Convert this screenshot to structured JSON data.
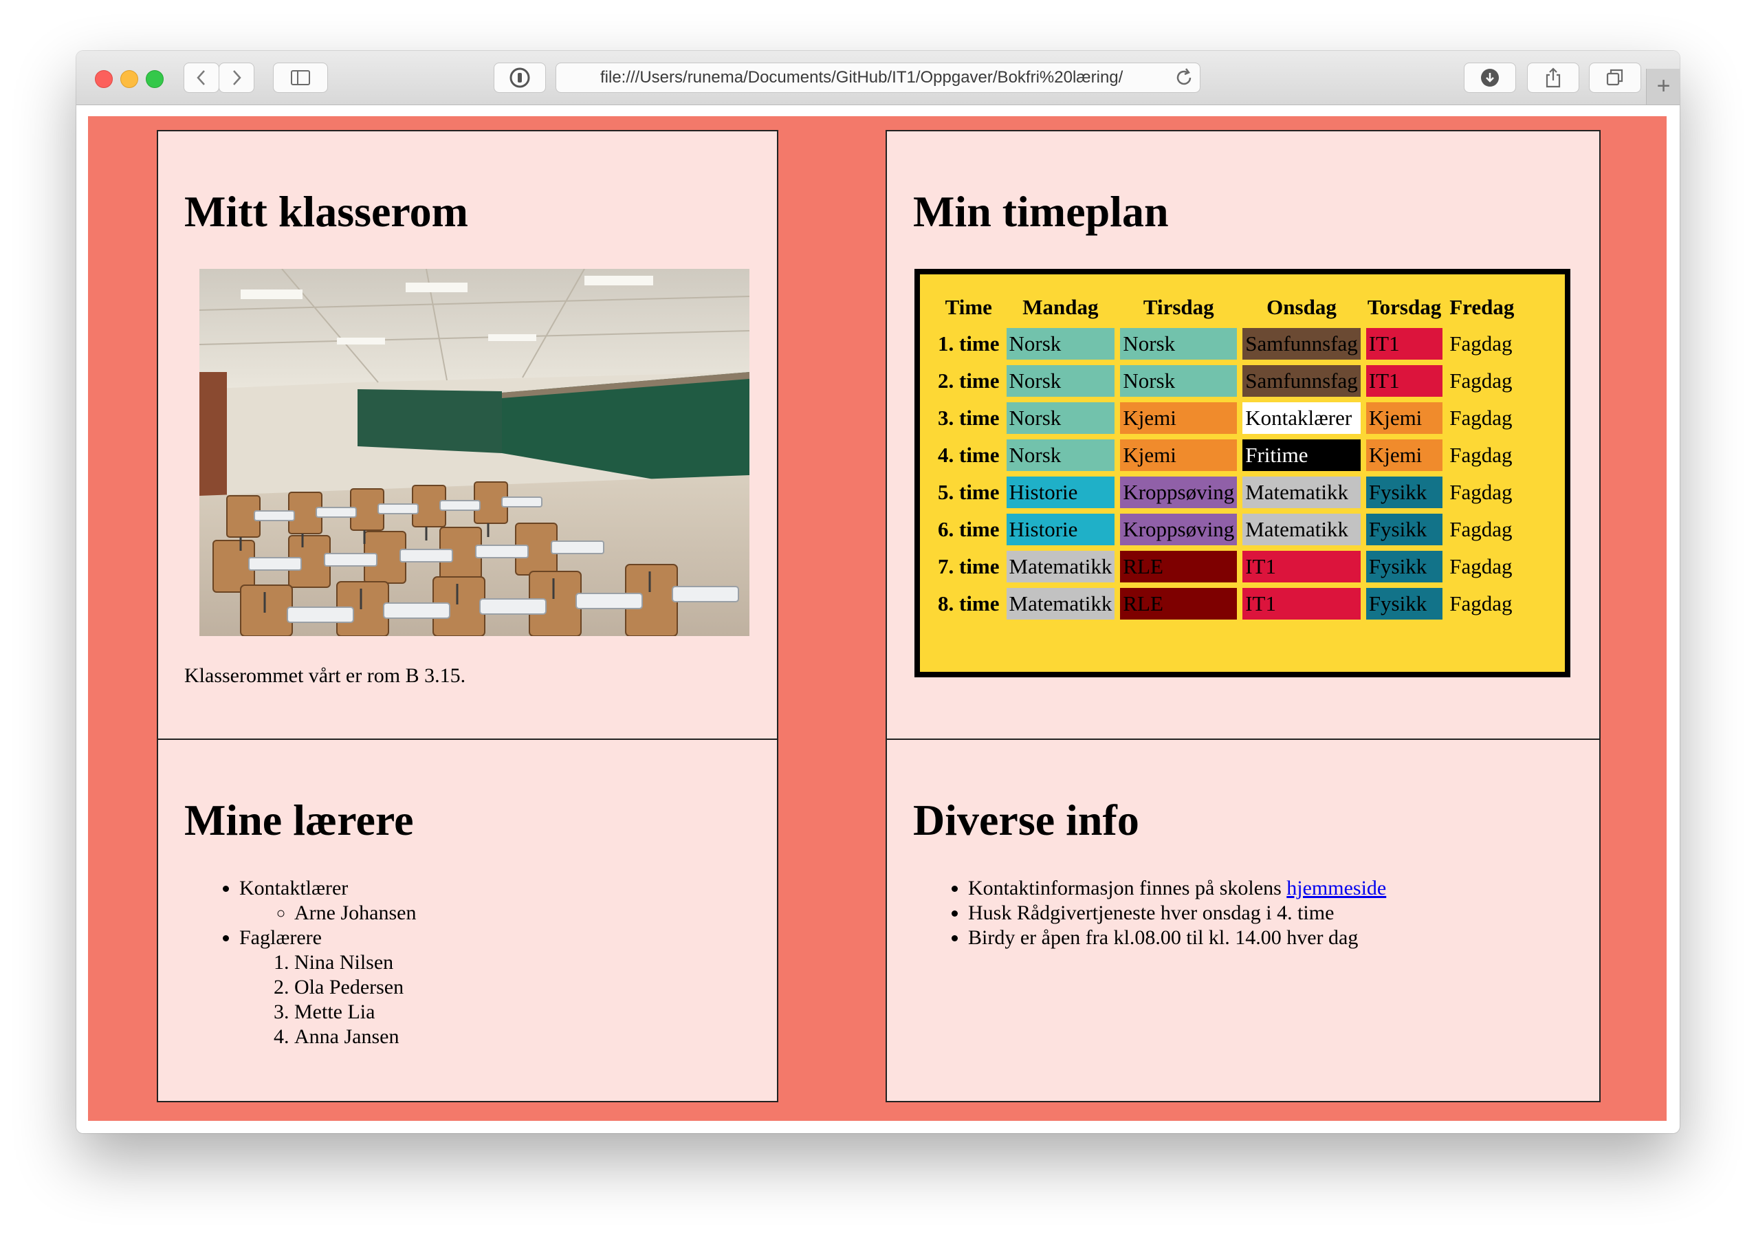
{
  "browser": {
    "url": "file:///Users/runema/Documents/GitHub/IT1/Oppgaver/Bokfri%20læring/"
  },
  "classroom": {
    "title": "Mitt klasserom",
    "caption": "Klasserommet vårt er rom B 3.15."
  },
  "schedule": {
    "title": "Min timeplan",
    "headers": [
      "Time",
      "Mandag",
      "Tirsdag",
      "Onsdag",
      "Torsdag",
      "Fredag"
    ],
    "rows": [
      {
        "time": "1. time",
        "cells": [
          "Norsk",
          "Norsk",
          "Samfunnsfag",
          "IT1",
          "Fagdag"
        ]
      },
      {
        "time": "2. time",
        "cells": [
          "Norsk",
          "Norsk",
          "Samfunnsfag",
          "IT1",
          "Fagdag"
        ]
      },
      {
        "time": "3. time",
        "cells": [
          "Norsk",
          "Kjemi",
          "Kontaklærer",
          "Kjemi",
          "Fagdag"
        ]
      },
      {
        "time": "4. time",
        "cells": [
          "Norsk",
          "Kjemi",
          "Fritime",
          "Kjemi",
          "Fagdag"
        ]
      },
      {
        "time": "5. time",
        "cells": [
          "Historie",
          "Kroppsøving",
          "Matematikk",
          "Fysikk",
          "Fagdag"
        ]
      },
      {
        "time": "6. time",
        "cells": [
          "Historie",
          "Kroppsøving",
          "Matematikk",
          "Fysikk",
          "Fagdag"
        ]
      },
      {
        "time": "7. time",
        "cells": [
          "Matematikk",
          "RLE",
          "IT1",
          "Fysikk",
          "Fagdag"
        ]
      },
      {
        "time": "8. time",
        "cells": [
          "Matematikk",
          "RLE",
          "IT1",
          "Fysikk",
          "Fagdag"
        ]
      }
    ],
    "subject_colors": {
      "Norsk": "#72c2ac",
      "Samfunnsfag": "#6b4a33",
      "IT1": "#dc143c",
      "Kjemi": "#f08b2c",
      "Kontaklærer": "#ffffff",
      "Fritime": "#000000",
      "Historie": "#1fb0c8",
      "Kroppsøving": "#9060a8",
      "Matematikk": "#c2c2c2",
      "Fysikk": "#127389",
      "RLE": "#7e0000",
      "Fagdag": "#fdd835"
    },
    "subject_text_colors": {
      "Fritime": "#ffffff"
    }
  },
  "teachers": {
    "title": "Mine lærere",
    "contact_label": "Kontaktlærer",
    "contact": "Arne Johansen",
    "subject_label": "Faglærere",
    "subject_teachers": [
      "Nina Nilsen",
      "Ola Pedersen",
      "Mette Lia",
      "Anna Jansen"
    ]
  },
  "info": {
    "title": "Diverse info",
    "item1_text": "Kontaktinformasjon finnes på skolens ",
    "item1_link": "hjemmeside",
    "item2": "Husk Rådgivertjeneste hver onsdag i 4. time",
    "item3": "Birdy er åpen fra kl.08.00 til kl. 14.00 hver dag"
  },
  "colors": {
    "page_background": "#f3796a",
    "box_background": "#fde2df",
    "timetable_background": "#fdd835"
  }
}
